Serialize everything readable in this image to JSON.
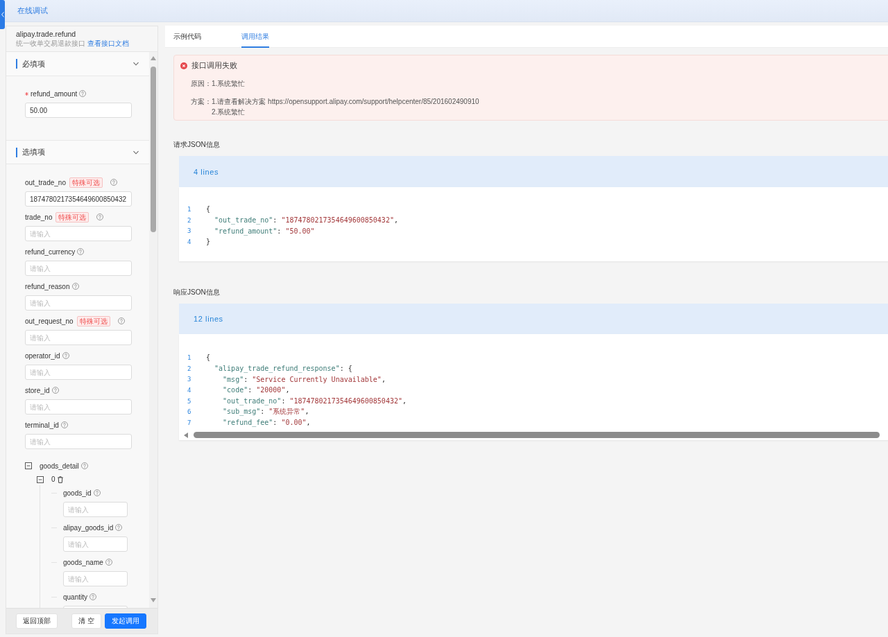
{
  "header": {
    "title": "在线调试"
  },
  "api": {
    "name": "alipay.trade.refund",
    "description": "统一收单交易退款接口",
    "doc_link": "查看接口文档"
  },
  "sections": [
    {
      "title": "必填项",
      "expanded": true,
      "fields": [
        {
          "kind": "input",
          "label": "refund_amount",
          "required": true,
          "value": "50.00"
        }
      ]
    },
    {
      "title": "选填项",
      "expanded": true,
      "fields": [
        {
          "kind": "input",
          "label": "out_trade_no",
          "required": false,
          "tag": "特殊可选",
          "value": "1874780217354649600850432"
        },
        {
          "kind": "input",
          "label": "trade_no",
          "required": false,
          "tag": "特殊可选",
          "placeholder": "请输入"
        },
        {
          "kind": "input",
          "label": "refund_currency",
          "required": false,
          "placeholder": "请输入"
        },
        {
          "kind": "input",
          "label": "refund_reason",
          "required": false,
          "placeholder": "请输入"
        },
        {
          "kind": "input",
          "label": "out_request_no",
          "required": false,
          "tag": "特殊可选",
          "placeholder": "请输入"
        },
        {
          "kind": "input",
          "label": "operator_id",
          "required": false,
          "placeholder": "请输入"
        },
        {
          "kind": "input",
          "label": "store_id",
          "required": false,
          "placeholder": "请输入"
        },
        {
          "kind": "input",
          "label": "terminal_id",
          "required": false,
          "placeholder": "请输入"
        },
        {
          "kind": "group",
          "label": "goods_detail",
          "expanded": true,
          "children": [
            {
              "kind": "item",
              "label": "0",
              "expanded": true,
              "children": [
                {
                  "kind": "input",
                  "label": "goods_id",
                  "required": false,
                  "placeholder": "请输入"
                },
                {
                  "kind": "input",
                  "label": "alipay_goods_id",
                  "required": false,
                  "placeholder": "请输入"
                },
                {
                  "kind": "input",
                  "label": "goods_name",
                  "required": false,
                  "placeholder": "请输入"
                },
                {
                  "kind": "input",
                  "label": "quantity",
                  "required": false
                }
              ]
            }
          ]
        }
      ]
    }
  ],
  "footer_buttons": [
    {
      "label": "返回顶部",
      "kind": "default"
    },
    {
      "label": "清 空",
      "kind": "default"
    },
    {
      "label": "发起调用",
      "kind": "primary"
    }
  ],
  "result_tabs": [
    {
      "label": "示例代码",
      "selected": false
    },
    {
      "label": "调用结果",
      "selected": true
    }
  ],
  "alert": {
    "kind": "error",
    "title": "接口调用失败",
    "reason_label": "原因：",
    "reasons": [
      "1.系统繁忙"
    ],
    "solution_label": "方案：",
    "solutions": [
      "1.请查看解决方案 https://opensupport.alipay.com/support/helpcenter/85/201602490910",
      "2.系统繁忙"
    ]
  },
  "code_blocks": [
    {
      "title": "请求JSON信息",
      "line_count": "4 lines",
      "scrollable": false,
      "lines": [
        {
          "number": "1",
          "tokens": [
            {
              "kind": "punct",
              "text": "{"
            }
          ]
        },
        {
          "number": "2",
          "tokens": [
            {
              "kind": "key",
              "text": "  \"out_trade_no\""
            },
            {
              "kind": "punct",
              "text": ": "
            },
            {
              "kind": "string",
              "text": "\"1874780217354649600850432\""
            },
            {
              "kind": "punct",
              "text": ","
            }
          ]
        },
        {
          "number": "3",
          "tokens": [
            {
              "kind": "key",
              "text": "  \"refund_amount\""
            },
            {
              "kind": "punct",
              "text": ": "
            },
            {
              "kind": "string",
              "text": "\"50.00\""
            }
          ]
        },
        {
          "number": "4",
          "tokens": [
            {
              "kind": "punct",
              "text": "}"
            }
          ]
        }
      ]
    },
    {
      "title": "响应JSON信息",
      "line_count": "12 lines",
      "scrollable": true,
      "lines": [
        {
          "number": "1",
          "tokens": [
            {
              "kind": "punct",
              "text": "{"
            }
          ]
        },
        {
          "number": "2",
          "tokens": [
            {
              "kind": "key",
              "text": "  \"alipay_trade_refund_response\""
            },
            {
              "kind": "punct",
              "text": ": {"
            }
          ]
        },
        {
          "number": "3",
          "tokens": [
            {
              "kind": "key",
              "text": "    \"msg\""
            },
            {
              "kind": "punct",
              "text": ": "
            },
            {
              "kind": "string",
              "text": "\"Service Currently Unavailable\""
            },
            {
              "kind": "punct",
              "text": ","
            }
          ]
        },
        {
          "number": "4",
          "tokens": [
            {
              "kind": "key",
              "text": "    \"code\""
            },
            {
              "kind": "punct",
              "text": ": "
            },
            {
              "kind": "string",
              "text": "\"20000\""
            },
            {
              "kind": "punct",
              "text": ","
            }
          ]
        },
        {
          "number": "5",
          "tokens": [
            {
              "kind": "key",
              "text": "    \"out_trade_no\""
            },
            {
              "kind": "punct",
              "text": ": "
            },
            {
              "kind": "string",
              "text": "\"1874780217354649600850432\""
            },
            {
              "kind": "punct",
              "text": ","
            }
          ]
        },
        {
          "number": "6",
          "tokens": [
            {
              "kind": "key",
              "text": "    \"sub_msg\""
            },
            {
              "kind": "punct",
              "text": ": "
            },
            {
              "kind": "string",
              "text": "\"系统异常\""
            },
            {
              "kind": "punct",
              "text": ","
            }
          ]
        },
        {
          "number": "7",
          "tokens": [
            {
              "kind": "key",
              "text": "    \"refund_fee\""
            },
            {
              "kind": "punct",
              "text": ": "
            },
            {
              "kind": "string",
              "text": "\"0.00\""
            },
            {
              "kind": "punct",
              "text": ","
            }
          ]
        }
      ]
    }
  ]
}
